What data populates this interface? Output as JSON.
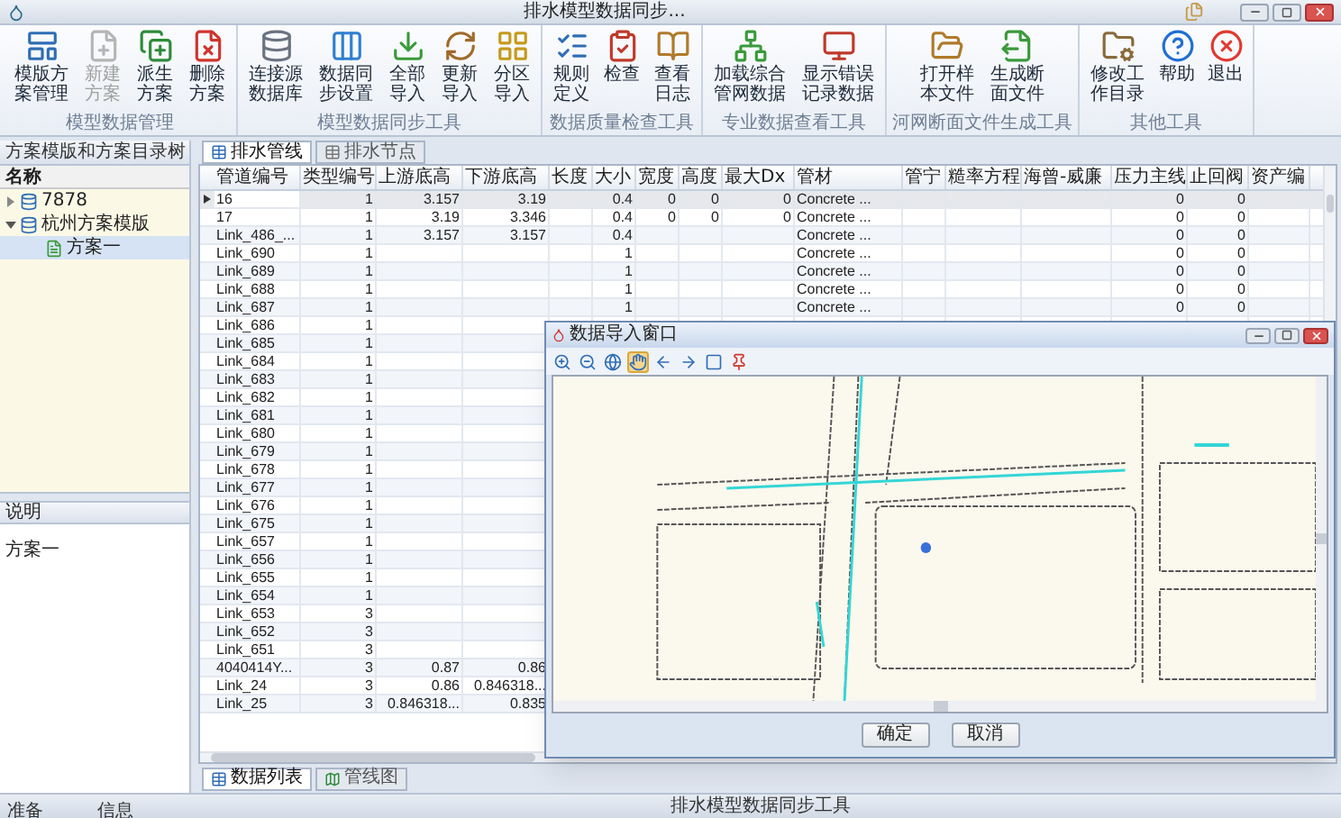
{
  "window": {
    "title": "排水模型数据同步..."
  },
  "ribbon": {
    "groups": [
      {
        "label": "模型数据管理",
        "buttons": [
          {
            "label": "模版方案管理",
            "disabled": false
          },
          {
            "label": "新建方案",
            "disabled": true
          },
          {
            "label": "派生方案",
            "disabled": false
          },
          {
            "label": "删除方案",
            "disabled": false
          }
        ]
      },
      {
        "label": "模型数据同步工具",
        "buttons": [
          {
            "label": "连接源数据库",
            "disabled": false
          },
          {
            "label": "数据同步设置",
            "disabled": false
          },
          {
            "label": "全部导入",
            "disabled": false
          },
          {
            "label": "更新导入",
            "disabled": false
          },
          {
            "label": "分区导入",
            "disabled": false
          }
        ]
      },
      {
        "label": "数据质量检查工具",
        "buttons": [
          {
            "label": "规则定义",
            "disabled": false
          },
          {
            "label": "检查",
            "disabled": false
          },
          {
            "label": "查看日志",
            "disabled": false
          }
        ]
      },
      {
        "label": "专业数据查看工具",
        "buttons": [
          {
            "label": "加载综合管网数据",
            "disabled": false
          },
          {
            "label": "显示错误记录数据",
            "disabled": false
          }
        ]
      },
      {
        "label": "河网断面文件生成工具",
        "buttons": [
          {
            "label": "打开样本文件",
            "disabled": false
          },
          {
            "label": "生成断面文件",
            "disabled": false
          }
        ]
      },
      {
        "label": "其他工具",
        "buttons": [
          {
            "label": "修改工作目录",
            "disabled": false
          },
          {
            "label": "帮助",
            "disabled": false
          },
          {
            "label": "退出",
            "disabled": false
          }
        ]
      }
    ]
  },
  "left_panel": {
    "title": "方案模版和方案目录树",
    "tree_header": "名称",
    "tree": [
      {
        "label": "7878",
        "expanded": false,
        "selected": false
      },
      {
        "label": "杭州方案模版",
        "expanded": true,
        "selected": false,
        "children": [
          {
            "label": "方案一",
            "selected": true
          }
        ]
      }
    ],
    "notes_title": "说明",
    "notes_text": "方案一"
  },
  "data_tabs": [
    {
      "label": "排水管线",
      "selected": true
    },
    {
      "label": "排水节点",
      "selected": false
    }
  ],
  "table": {
    "columns": [
      "管道编号",
      "类型编号",
      "上游底高",
      "下游底高",
      "长度",
      "大小",
      "宽度",
      "高度",
      "最大Dx",
      "管材",
      "管宁",
      "糙率方程",
      "海曾-威廉",
      "压力主线",
      "止回阀",
      "资产编"
    ],
    "rows": [
      {
        "selected": true,
        "cells": [
          "16",
          "1",
          "3.157",
          "3.19",
          null,
          "0.4",
          "0",
          "0",
          "0",
          "Concrete ...",
          null,
          null,
          null,
          "0",
          "0",
          null
        ]
      },
      {
        "selected": false,
        "cells": [
          "17",
          "1",
          "3.19",
          "3.346",
          null,
          "0.4",
          "0",
          "0",
          "0",
          "Concrete ...",
          null,
          null,
          null,
          "0",
          "0",
          null
        ]
      },
      {
        "selected": false,
        "cells": [
          "Link_486_...",
          "1",
          "3.157",
          "3.157",
          null,
          "0.4",
          null,
          null,
          null,
          "Concrete ...",
          null,
          null,
          null,
          "0",
          "0",
          null
        ]
      },
      {
        "selected": false,
        "cells": [
          "Link_690",
          "1",
          null,
          null,
          null,
          "1",
          null,
          null,
          null,
          "Concrete ...",
          null,
          null,
          null,
          "0",
          "0",
          null
        ]
      },
      {
        "selected": false,
        "cells": [
          "Link_689",
          "1",
          null,
          null,
          null,
          "1",
          null,
          null,
          null,
          "Concrete ...",
          null,
          null,
          null,
          "0",
          "0",
          null
        ]
      },
      {
        "selected": false,
        "cells": [
          "Link_688",
          "1",
          null,
          null,
          null,
          "1",
          null,
          null,
          null,
          "Concrete ...",
          null,
          null,
          null,
          "0",
          "0",
          null
        ]
      },
      {
        "selected": false,
        "cells": [
          "Link_687",
          "1",
          null,
          null,
          null,
          "1",
          null,
          null,
          null,
          "Concrete ...",
          null,
          null,
          null,
          "0",
          "0",
          null
        ]
      },
      {
        "selected": false,
        "cells": [
          "Link_686",
          "1"
        ]
      },
      {
        "selected": false,
        "cells": [
          "Link_685",
          "1"
        ]
      },
      {
        "selected": false,
        "cells": [
          "Link_684",
          "1"
        ]
      },
      {
        "selected": false,
        "cells": [
          "Link_683",
          "1"
        ]
      },
      {
        "selected": false,
        "cells": [
          "Link_682",
          "1"
        ]
      },
      {
        "selected": false,
        "cells": [
          "Link_681",
          "1"
        ]
      },
      {
        "selected": false,
        "cells": [
          "Link_680",
          "1"
        ]
      },
      {
        "selected": false,
        "cells": [
          "Link_679",
          "1"
        ]
      },
      {
        "selected": false,
        "cells": [
          "Link_678",
          "1"
        ]
      },
      {
        "selected": false,
        "cells": [
          "Link_677",
          "1"
        ]
      },
      {
        "selected": false,
        "cells": [
          "Link_676",
          "1"
        ]
      },
      {
        "selected": false,
        "cells": [
          "Link_675",
          "1"
        ]
      },
      {
        "selected": false,
        "cells": [
          "Link_657",
          "1"
        ]
      },
      {
        "selected": false,
        "cells": [
          "Link_656",
          "1"
        ]
      },
      {
        "selected": false,
        "cells": [
          "Link_655",
          "1"
        ]
      },
      {
        "selected": false,
        "cells": [
          "Link_654",
          "1"
        ]
      },
      {
        "selected": false,
        "cells": [
          "Link_653",
          "3"
        ]
      },
      {
        "selected": false,
        "cells": [
          "Link_652",
          "3"
        ]
      },
      {
        "selected": false,
        "cells": [
          "Link_651",
          "3"
        ]
      },
      {
        "selected": false,
        "cells": [
          "4040414Y...",
          "3",
          "0.87",
          "0.86"
        ]
      },
      {
        "selected": false,
        "cells": [
          "Link_24",
          "3",
          "0.86",
          "0.846318..."
        ]
      },
      {
        "selected": false,
        "cells": [
          "Link_25",
          "3",
          "0.846318...",
          "0.835"
        ]
      }
    ]
  },
  "view_tabs": [
    {
      "label": "数据列表",
      "selected": true
    },
    {
      "label": "管线图",
      "selected": false
    }
  ],
  "status_bar": [
    "准备",
    "信息",
    "排水模型数据同步工具"
  ],
  "dialog": {
    "title": "数据导入窗口",
    "tools": [
      {
        "selected": false
      },
      {
        "selected": false
      },
      {
        "selected": false
      },
      {
        "selected": true
      },
      {
        "selected": false
      },
      {
        "selected": false
      },
      {
        "selected": false
      },
      {
        "selected": false
      }
    ],
    "buttons": [
      "确定",
      "取消"
    ]
  }
}
